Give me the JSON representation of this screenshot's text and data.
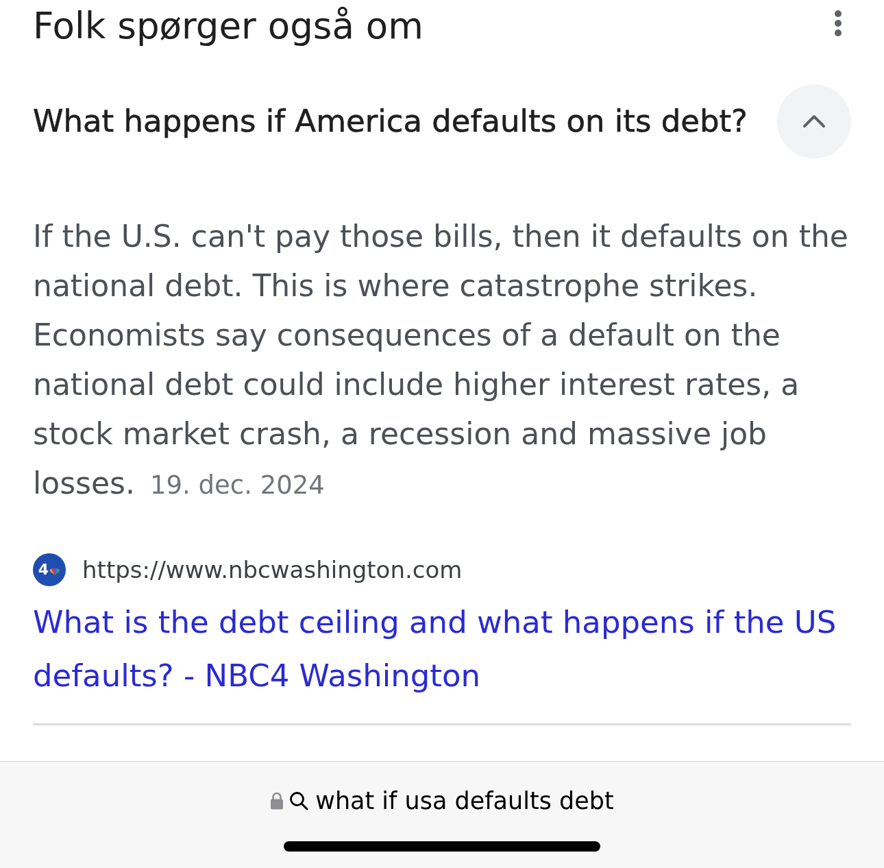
{
  "header": {
    "title": "Folk spørger også om"
  },
  "questions": [
    {
      "question": "What happens if America defaults on its debt?",
      "expanded": true,
      "answer": {
        "text": "If the U.S. can't pay those bills, then it defaults on the national debt. This is where catastrophe strikes. Economists say consequences of a default on the national debt could include higher interest rates, a stock market crash, a recession and massive job losses.",
        "date": "19. dec. 2024"
      },
      "source": {
        "favicon_text": "4",
        "url": "https://www.nbcwashington.com",
        "title": "What is the debt ceiling and what happens if the US defaults? - NBC4 Washington"
      }
    }
  ],
  "address_bar": {
    "secure": true,
    "query": "what if usa defaults debt"
  }
}
